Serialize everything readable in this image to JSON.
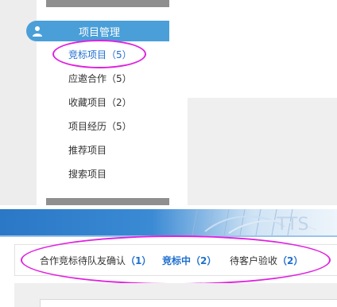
{
  "sidebar": {
    "section_title": "项目管理",
    "items": [
      {
        "label": "竞标项目",
        "count": "（5）",
        "active": true
      },
      {
        "label": "应邀合作",
        "count": "（5）",
        "active": false
      },
      {
        "label": "收藏项目",
        "count": "（2）",
        "active": false
      },
      {
        "label": "项目经历",
        "count": "（5）",
        "active": false
      },
      {
        "label": "推荐项目",
        "count": "",
        "active": false
      },
      {
        "label": "搜索项目",
        "count": "",
        "active": false
      }
    ]
  },
  "banner": {
    "art_text": "TTS"
  },
  "tabs": [
    {
      "label": "合作竞标待队友确认",
      "count": "（1）",
      "active": false
    },
    {
      "label": "竞标中",
      "count": "（2）",
      "active": true
    },
    {
      "label": "待客户验收",
      "count": "（2）",
      "active": false
    }
  ],
  "colors": {
    "accent": "#4a9fd8",
    "active_text": "#1f6fd0",
    "highlight_ellipse": "#e020e0"
  },
  "icons": {
    "section": "user-icon"
  }
}
